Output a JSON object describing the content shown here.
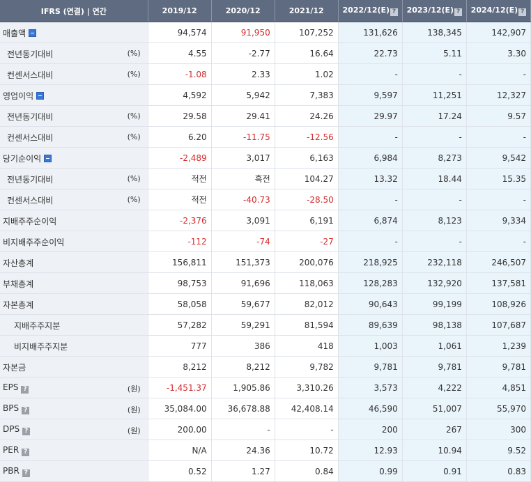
{
  "header": [
    "IFRS (연결) | 연간",
    "2019/12",
    "2020/12",
    "2021/12",
    "2022/12(E)",
    "2023/12(E)",
    "2024/12(E)"
  ],
  "help_icon": "?",
  "rows": [
    {
      "label": "매출액",
      "indent": 0,
      "unit": "",
      "icon": "minus",
      "values": [
        "94,574",
        "91,950",
        "107,252",
        "131,626",
        "138,345",
        "142,907"
      ]
    },
    {
      "label": "전년동기대비",
      "indent": 2,
      "unit": "(%)",
      "icon": "",
      "values": [
        "4.55",
        "-2.77",
        "16.64",
        "22.73",
        "5.11",
        "3.30"
      ]
    },
    {
      "label": "컨센서스대비",
      "indent": 2,
      "unit": "(%)",
      "icon": "",
      "values": [
        "-1.08",
        "2.33",
        "1.02",
        "-",
        "-",
        "-"
      ]
    },
    {
      "label": "영업이익",
      "indent": 0,
      "unit": "",
      "icon": "minus",
      "values": [
        "4,592",
        "5,942",
        "7,383",
        "9,597",
        "11,251",
        "12,327"
      ]
    },
    {
      "label": "전년동기대비",
      "indent": 2,
      "unit": "(%)",
      "icon": "",
      "values": [
        "29.58",
        "29.41",
        "24.26",
        "29.97",
        "17.24",
        "9.57"
      ]
    },
    {
      "label": "컨센서스대비",
      "indent": 2,
      "unit": "(%)",
      "icon": "",
      "values": [
        "6.20",
        "-11.75",
        "-12.56",
        "-",
        "-",
        "-"
      ]
    },
    {
      "label": "당기순이익",
      "indent": 0,
      "unit": "",
      "icon": "minus",
      "values": [
        "-2,489",
        "3,017",
        "6,163",
        "6,984",
        "8,273",
        "9,542"
      ]
    },
    {
      "label": "전년동기대비",
      "indent": 2,
      "unit": "(%)",
      "icon": "",
      "values": [
        "적전",
        "흑전",
        "104.27",
        "13.32",
        "18.44",
        "15.35"
      ]
    },
    {
      "label": "컨센서스대비",
      "indent": 2,
      "unit": "(%)",
      "icon": "",
      "values": [
        "적전",
        "-40.73",
        "-28.50",
        "-",
        "-",
        "-"
      ]
    },
    {
      "label": "지배주주순이익",
      "indent": 0,
      "unit": "",
      "icon": "",
      "values": [
        "-2,376",
        "3,091",
        "6,191",
        "6,874",
        "8,123",
        "9,334"
      ]
    },
    {
      "label": "비지배주주순이익",
      "indent": 0,
      "unit": "",
      "icon": "",
      "values": [
        "-112",
        "-74",
        "-27",
        "-",
        "-",
        "-"
      ]
    },
    {
      "label": "자산총계",
      "indent": 0,
      "unit": "",
      "icon": "",
      "values": [
        "156,811",
        "151,373",
        "200,076",
        "218,925",
        "232,118",
        "246,507"
      ]
    },
    {
      "label": "부채총계",
      "indent": 0,
      "unit": "",
      "icon": "",
      "values": [
        "98,753",
        "91,696",
        "118,063",
        "128,283",
        "132,920",
        "137,581"
      ]
    },
    {
      "label": "자본총계",
      "indent": 0,
      "unit": "",
      "icon": "",
      "values": [
        "58,058",
        "59,677",
        "82,012",
        "90,643",
        "99,199",
        "108,926"
      ]
    },
    {
      "label": "지배주주지분",
      "indent": 1,
      "unit": "",
      "icon": "",
      "values": [
        "57,282",
        "59,291",
        "81,594",
        "89,639",
        "98,138",
        "107,687"
      ]
    },
    {
      "label": "비지배주주지분",
      "indent": 1,
      "unit": "",
      "icon": "",
      "values": [
        "777",
        "386",
        "418",
        "1,003",
        "1,061",
        "1,239"
      ]
    },
    {
      "label": "자본금",
      "indent": 0,
      "unit": "",
      "icon": "",
      "values": [
        "8,212",
        "8,212",
        "9,782",
        "9,781",
        "9,781",
        "9,781"
      ]
    },
    {
      "label": "EPS",
      "indent": 0,
      "unit": "(원)",
      "icon": "help",
      "values": [
        "-1,451.37",
        "1,905.86",
        "3,310.26",
        "3,573",
        "4,222",
        "4,851"
      ]
    },
    {
      "label": "BPS",
      "indent": 0,
      "unit": "(원)",
      "icon": "help",
      "values": [
        "35,084.00",
        "36,678.88",
        "42,408.14",
        "46,590",
        "51,007",
        "55,970"
      ]
    },
    {
      "label": "DPS",
      "indent": 0,
      "unit": "(원)",
      "icon": "help",
      "values": [
        "200.00",
        "-",
        "-",
        "200",
        "267",
        "300"
      ]
    },
    {
      "label": "PER",
      "indent": 0,
      "unit": "",
      "icon": "help",
      "values": [
        "N/A",
        "24.36",
        "10.72",
        "12.93",
        "10.94",
        "9.52"
      ]
    },
    {
      "label": "PBR",
      "indent": 0,
      "unit": "",
      "icon": "help",
      "values": [
        "0.52",
        "1.27",
        "0.84",
        "0.99",
        "0.91",
        "0.83"
      ]
    }
  ],
  "negative_cells": [
    [
      0,
      1
    ],
    [
      2,
      0
    ],
    [
      5,
      1
    ],
    [
      5,
      2
    ],
    [
      6,
      0
    ],
    [
      8,
      1
    ],
    [
      8,
      2
    ],
    [
      9,
      0
    ],
    [
      10,
      0
    ],
    [
      10,
      1
    ],
    [
      10,
      2
    ],
    [
      17,
      0
    ]
  ],
  "colors": {
    "header_bg": "#5f6b80",
    "label_bg": "#eef1f6",
    "estimate_bg": "#eaf4fb",
    "negative": "#d42b2b",
    "minus_icon": "#3a78d8"
  }
}
